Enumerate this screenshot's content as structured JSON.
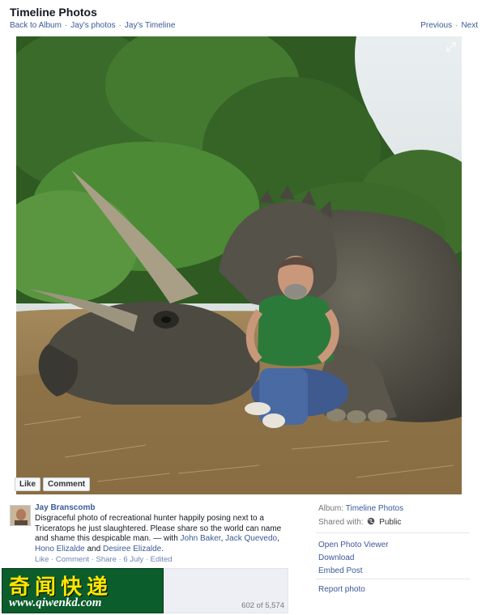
{
  "header": {
    "title": "Timeline Photos",
    "breadcrumb": [
      "Back to Album",
      "Jay's photos",
      "Jay's Timeline"
    ],
    "pager": {
      "previous": "Previous",
      "next": "Next"
    }
  },
  "photo": {
    "actions": {
      "like": "Like",
      "comment": "Comment"
    }
  },
  "post": {
    "author": "Jay Branscomb",
    "text_main": "Disgraceful photo of recreational hunter happily posing next to a Triceratops he just slaughtered. Please share so the world can name and shame this despicable man.",
    "text_with": " — with ",
    "tagged": [
      "John Baker",
      "Jack Quevedo",
      "Hono Elizalde",
      "Desiree Elizalde"
    ],
    "text_and": " and ",
    "meta": {
      "like": "Like",
      "comment": "Comment",
      "share": "Share",
      "date": "6 July",
      "edited": "Edited"
    }
  },
  "comments": {
    "counter": "602 of 5,574"
  },
  "sidebar": {
    "album_label": "Album:",
    "album_value": "Timeline Photos",
    "shared_label": "Shared with:",
    "shared_value": "Public",
    "actions": [
      "Open Photo Viewer",
      "Download",
      "Embed Post",
      "Report photo"
    ]
  },
  "watermark": {
    "chinese": "奇闻快递",
    "url": "www.qiwenkd.com"
  },
  "colors": {
    "link": "#3b5998",
    "watermark_bg": "#0b5d2c",
    "watermark_text": "#ffe600"
  }
}
